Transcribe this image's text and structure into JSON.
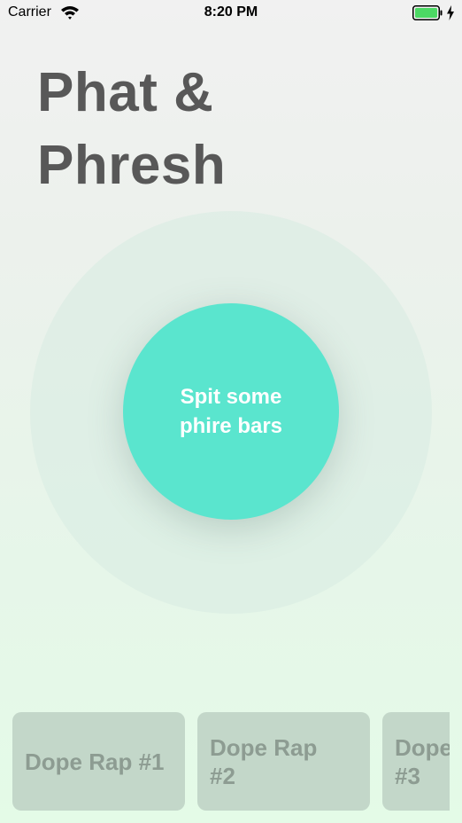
{
  "status_bar": {
    "carrier": "Carrier",
    "time": "8:20 PM",
    "icons": [
      "wifi-icon",
      "battery-icon",
      "charging-bolt-icon"
    ],
    "battery_color": "#4cd964"
  },
  "header": {
    "title_line1": "Phat &",
    "title_line2": "Phresh"
  },
  "record": {
    "label_line1": "Spit some",
    "label_line2": "phire bars",
    "color": "#5ae5ce"
  },
  "raps": [
    {
      "line1": "Dope Rap #1",
      "line2": ""
    },
    {
      "line1": "Dope Rap",
      "line2": "#2"
    },
    {
      "line1": "Dope Rap",
      "line2": "#3"
    }
  ]
}
